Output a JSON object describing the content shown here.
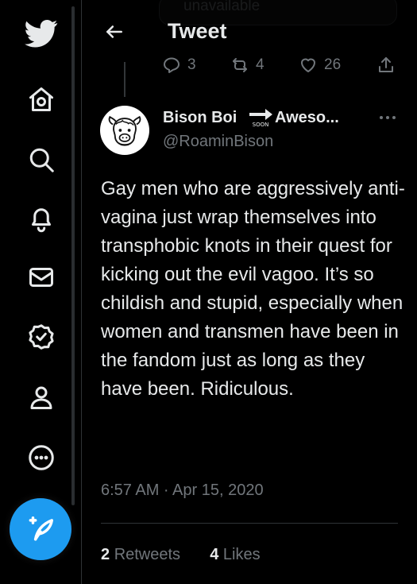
{
  "sidebar": {
    "icons": [
      "twitter-logo-icon",
      "home-icon",
      "search-icon",
      "bell-icon",
      "mail-icon",
      "verified-icon",
      "profile-icon",
      "more-circle-icon"
    ],
    "compose_icon": "compose-feather-icon"
  },
  "parent_tweet": {
    "unavailable_text": "unavailable",
    "reply_count": "3",
    "retweet_count": "4",
    "like_count": "26"
  },
  "header": {
    "title": "Tweet"
  },
  "tweet": {
    "author_name": "Bison Boi",
    "author_name_suffix": "Aweso...",
    "emoji": "soon-arrow-emoji",
    "emoji_text": "SOON",
    "handle": "@RoaminBison",
    "text": "Gay men who are aggressively anti-vagina just wrap themselves into transphobic knots in their quest for kicking out the evil vagoo. It’s so childish and stupid, especially when women and transmen have been in the fandom just as long as they have been. Ridiculous.",
    "timestamp": "6:57 AM · Apr 15, 2020",
    "retweets_count": "2",
    "retweets_label": "Retweets",
    "likes_count": "4",
    "likes_label": "Likes"
  },
  "colors": {
    "background": "#000000",
    "text": "#e7e9ea",
    "muted": "#71767b",
    "accent": "#1d9bf0",
    "border": "#2f3336"
  }
}
